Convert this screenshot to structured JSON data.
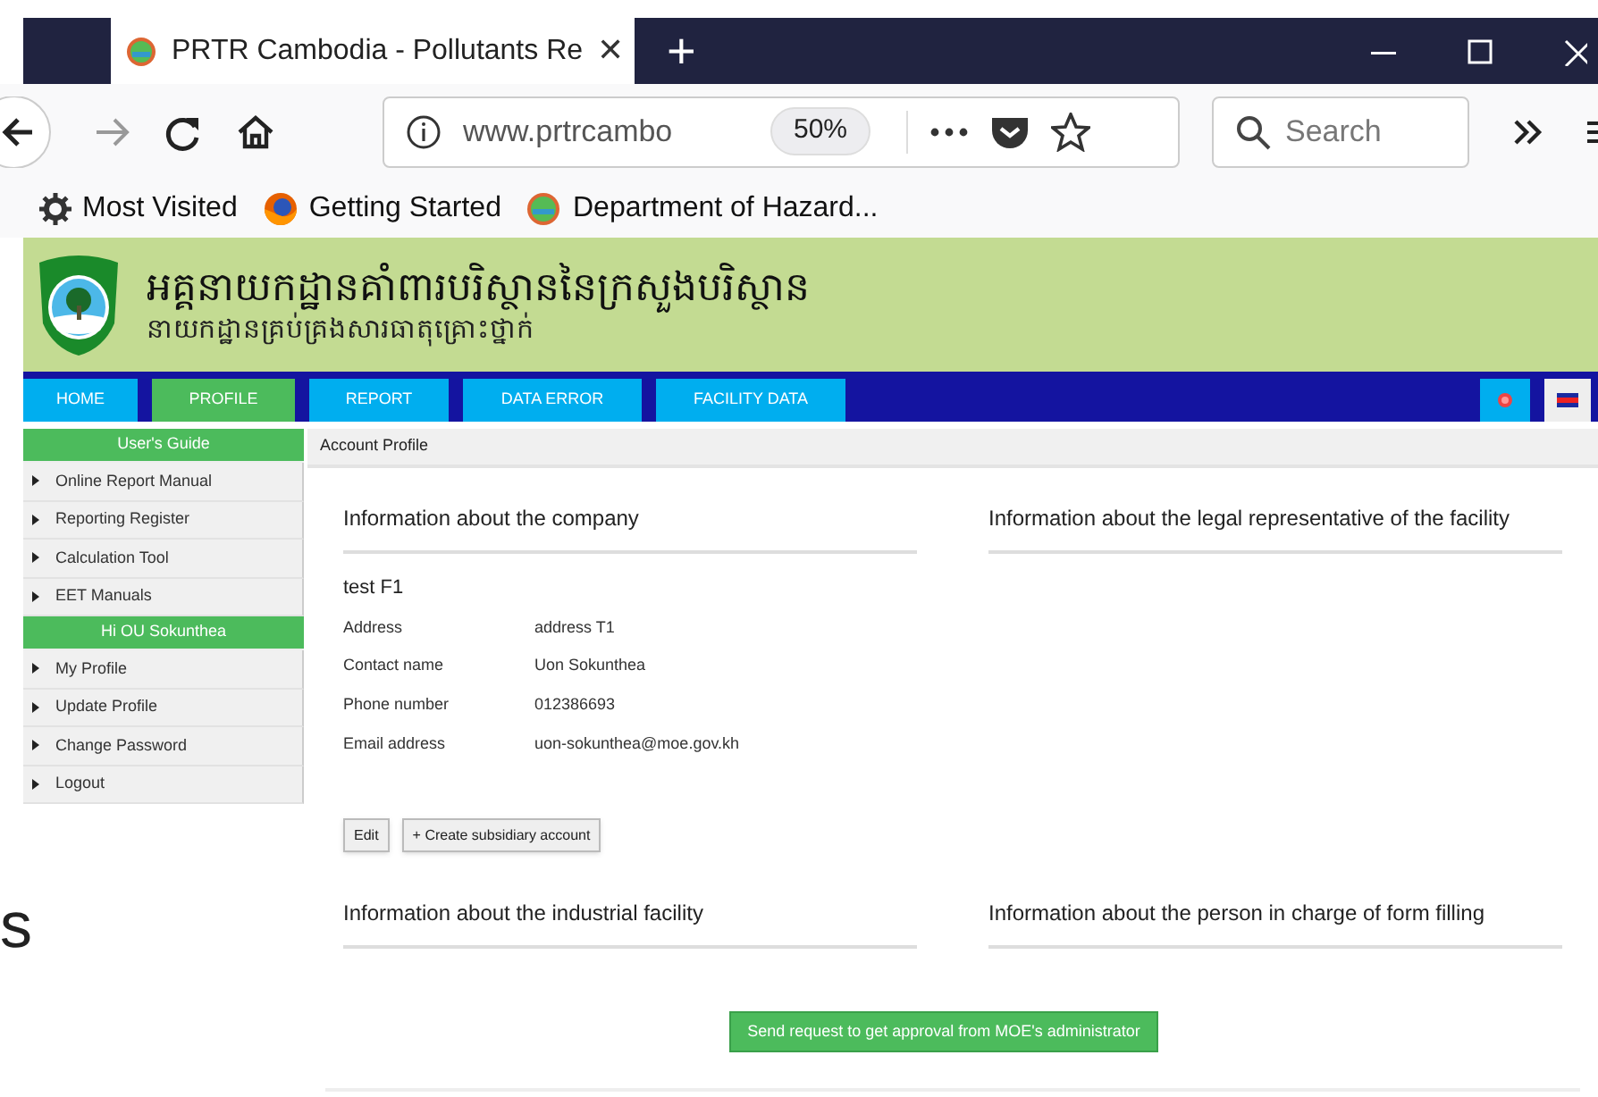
{
  "browser": {
    "tab": {
      "title": "PRTR Cambodia - Pollutants Re",
      "close": "✕",
      "selected": true
    },
    "new_tab": "+",
    "url": "www.prtrcambo",
    "zoom": "50%",
    "search_placeholder": "Search",
    "bookmarks": [
      {
        "label": "Most Visited",
        "kind": "gear"
      },
      {
        "label": "Getting Started",
        "kind": "firefox"
      },
      {
        "label": "Department of Hazard...",
        "kind": "site"
      }
    ]
  },
  "site": {
    "title_line1": "អគ្គនាយកដ្ឋានគាំពារបរិស្ថាននៃក្រសួងបរិស្ថាន",
    "title_line2": "នាយកដ្ឋានគ្រប់គ្រងសារធាតុគ្រោះថ្នាក់"
  },
  "nav": [
    {
      "label": "HOME",
      "selected": false
    },
    {
      "label": "PROFILE",
      "selected": true
    },
    {
      "label": "REPORT",
      "selected": false
    },
    {
      "label": "DATA ERROR",
      "selected": false
    },
    {
      "label": "FACILITY DATA",
      "selected": false
    }
  ],
  "sidebar": [
    {
      "heading": "User's Guide",
      "items": [
        "Online Report Manual",
        "Reporting Register",
        "Calculation Tool",
        "EET Manuals"
      ]
    },
    {
      "heading": "Hi OU Sokunthea",
      "items": [
        "My Profile",
        "Update Profile",
        "Change Password",
        "Logout"
      ]
    }
  ],
  "breadcrumb": "Account Profile",
  "company": {
    "heading": "Information about the company",
    "name": "test F1",
    "fields": [
      {
        "label": "Address",
        "value": "address T1"
      },
      {
        "label": "Contact name",
        "value": "Uon Sokunthea"
      },
      {
        "label": "Phone number",
        "value": "012386693"
      },
      {
        "label": "Email address",
        "value": "uon-sokunthea@moe.gov.kh"
      }
    ]
  },
  "legal_heading": "Information about the legal representative of the facility",
  "buttons": [
    "Edit",
    "+ Create subsidiary account"
  ],
  "facility_heading": "Information about the industrial facility",
  "person_heading": "Information about the person in charge of form filling",
  "submit": "Send request to get approval from MOE's administrator",
  "background_text": "s"
}
